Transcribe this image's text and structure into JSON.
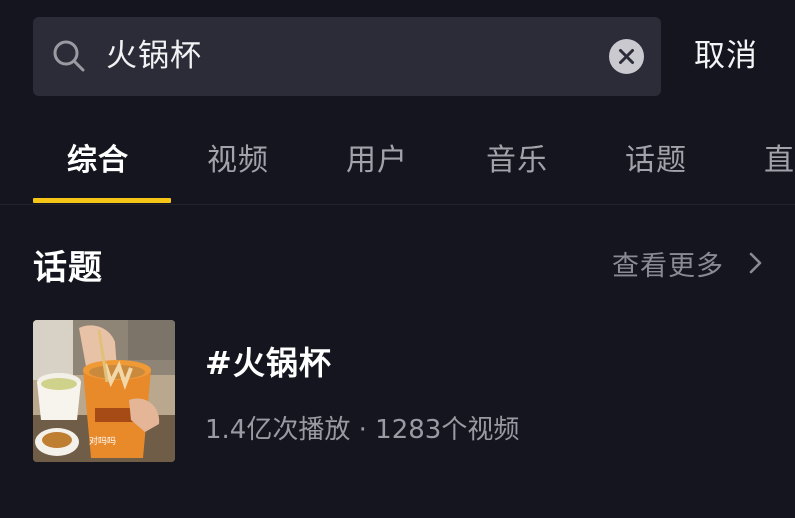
{
  "search": {
    "query": "火锅杯",
    "cancel_label": "取消"
  },
  "tabs": [
    {
      "label": "综合",
      "active": true
    },
    {
      "label": "视频",
      "active": false
    },
    {
      "label": "用户",
      "active": false
    },
    {
      "label": "音乐",
      "active": false
    },
    {
      "label": "话题",
      "active": false
    },
    {
      "label": "直",
      "active": false
    }
  ],
  "section": {
    "title": "话题",
    "see_more_label": "查看更多"
  },
  "topic": {
    "name": "#火锅杯",
    "plays": "1.4亿次播放",
    "separator": "·",
    "videos": "1283个视频",
    "thumbnail_caption": "对吗吗"
  },
  "colors": {
    "background": "#15151f",
    "search_bg": "#2c2c38",
    "accent": "#f5c518"
  }
}
